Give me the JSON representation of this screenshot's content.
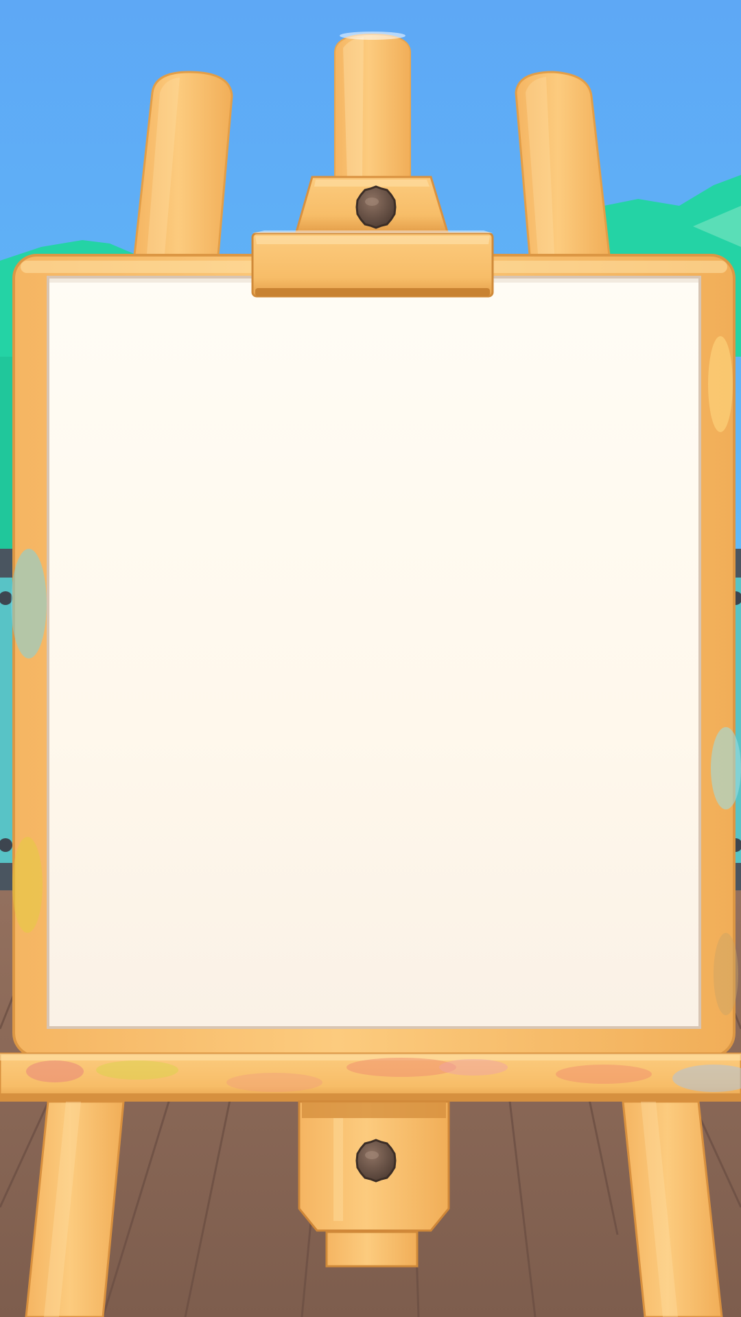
{
  "scene": {
    "kind": "painting-easel",
    "canvas_state": "blank",
    "palette": {
      "sky_top": "#5EA8F5",
      "sky_bottom": "#63C7FB",
      "hills": "#24D3A5",
      "hills_light": "#7FE6C3",
      "railing": "#4A5560",
      "railing_bg": "#58C3C6",
      "floor": "#8A6756",
      "floor_line": "#6C4F43",
      "wood_light": "#FCCB7E",
      "wood_mid": "#F5B562",
      "wood_dark": "#D9913F",
      "canvas": "#FFFBF2",
      "knob": "#6B5448"
    },
    "icons": [
      "wing-nut-icon",
      "wing-nut-icon"
    ]
  }
}
